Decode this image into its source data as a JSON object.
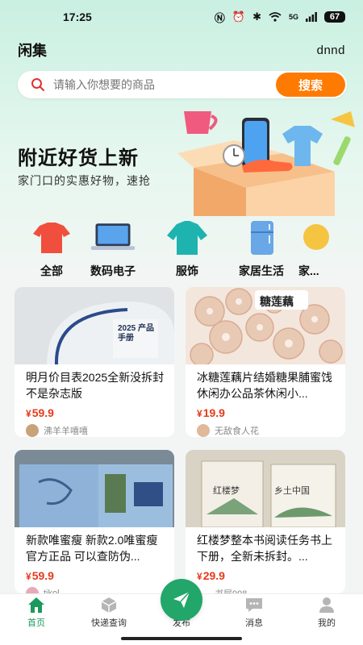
{
  "status_bar": {
    "time": "17:25",
    "signal_label": "5G",
    "battery": "67"
  },
  "header": {
    "title": "闲集",
    "user": "dnnd"
  },
  "search": {
    "placeholder": "请输入你想要的商品",
    "button": "搜索",
    "icon": "search-icon"
  },
  "banner": {
    "title": "附近好货上新",
    "subtitle": "家门口的实惠好物，速抢"
  },
  "categories": [
    {
      "label": "全部",
      "icon": "tshirt-icon"
    },
    {
      "label": "数码电子",
      "icon": "laptop-icon"
    },
    {
      "label": "服饰",
      "icon": "sweater-icon"
    },
    {
      "label": "家居生活",
      "icon": "fridge-icon"
    },
    {
      "label": "家...",
      "icon": "lamp-icon"
    }
  ],
  "products": [
    {
      "title": "明月价目表2025全新没拆封 不是杂志版",
      "price": "59.9",
      "currency": "¥",
      "seller": "沸羊羊嘻嘻",
      "image_text": "2025 产品手册"
    },
    {
      "title": "冰糖莲藕片结婚糖果脯蜜饯休闲办公品茶休闲小...",
      "price": "19.9",
      "currency": "¥",
      "seller": "无敌食人花",
      "image_text": "糖莲藕"
    },
    {
      "title": "新款唯蜜瘦 新款2.0唯蜜瘦 官方正品 可以查防伪...",
      "price": "59.9",
      "currency": "¥",
      "seller": "tikol",
      "image_text": ""
    },
    {
      "title": "红楼梦整本书阅读任务书上下册，全新未拆封。...",
      "price": "29.9",
      "currency": "¥",
      "seller": "书屋998",
      "image_text": "红楼梦 乡土中国"
    }
  ],
  "tab_bar": {
    "items": [
      {
        "label": "首页",
        "icon": "home-icon",
        "active": true
      },
      {
        "label": "快递查询",
        "icon": "package-icon",
        "active": false
      },
      {
        "label": "发布",
        "icon": "send-icon",
        "active": false
      },
      {
        "label": "消息",
        "icon": "message-icon",
        "active": false
      },
      {
        "label": "我的",
        "icon": "profile-icon",
        "active": false
      }
    ]
  },
  "colors": {
    "accent": "#ff7a00",
    "brand_green": "#22a66a",
    "price_red": "#e53a1c"
  }
}
